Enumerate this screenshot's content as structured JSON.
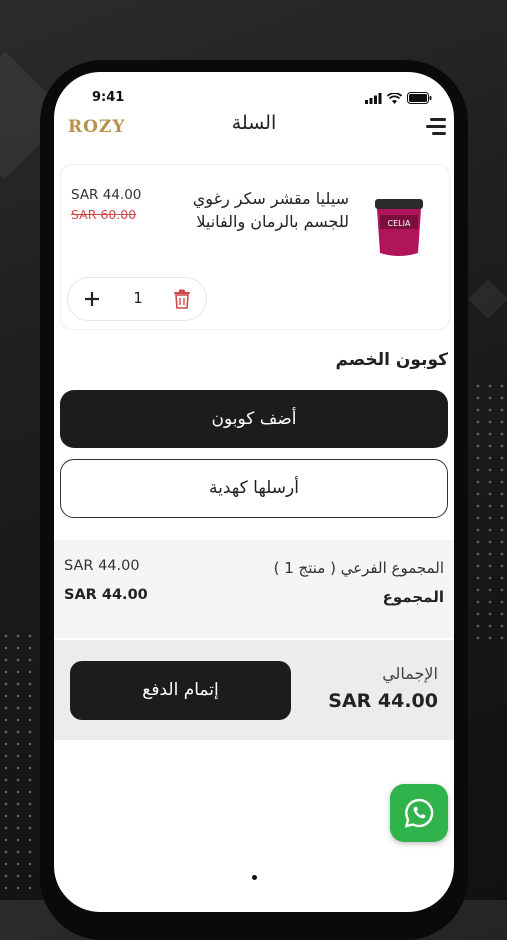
{
  "status_bar": {
    "time": "9:41"
  },
  "header": {
    "logo_text": "ROZY",
    "title": "السلة"
  },
  "cart_item": {
    "name": "سيليا مقشر سكر رغوي للجسم بالرمان والفانيلا",
    "image_label": "CELIA",
    "price": "SAR 44.00",
    "old_price": "SAR 60.00",
    "quantity": "1"
  },
  "coupon": {
    "section_title": "كوبون الخصم",
    "add_coupon_label": "أضف كوبون",
    "send_gift_label": "أرسلها كهدية"
  },
  "summary": {
    "subtotal_label": "المجموع الفرعي ( منتج 1 )",
    "subtotal_value": "SAR 44.00",
    "total_label": "المجموع",
    "total_value": "SAR 44.00"
  },
  "checkout": {
    "grand_total_label": "الإجمالي",
    "grand_total_value": "SAR 44.00",
    "button_label": "إتمام الدفع"
  },
  "colors": {
    "accent_dark": "#1d1b1c",
    "whatsapp_green": "#2fb34a",
    "delete_red": "#d04848",
    "logo_gold": "#b8904a"
  },
  "icons": [
    "menu-icon",
    "trash-icon",
    "plus-icon",
    "whatsapp-icon",
    "signal-icon",
    "wifi-icon",
    "battery-icon"
  ]
}
